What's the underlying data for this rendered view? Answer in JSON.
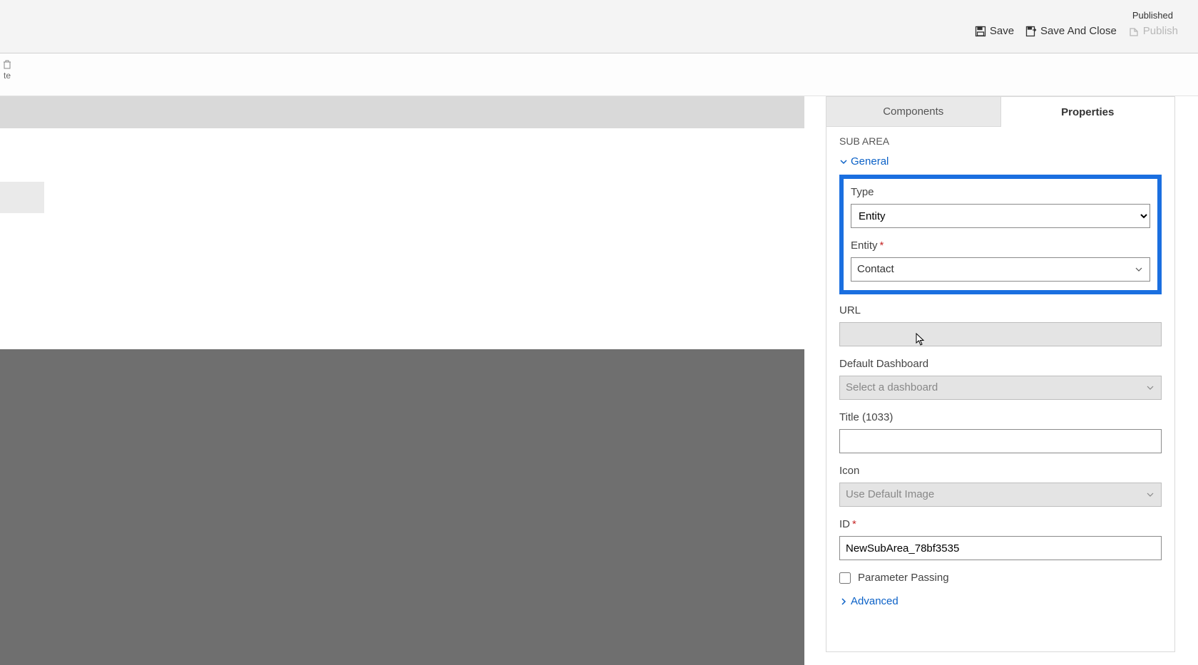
{
  "header": {
    "status_label": "Published",
    "buttons": {
      "save": "Save",
      "save_and_close": "Save And Close",
      "publish": "Publish"
    },
    "delete_label": "te"
  },
  "panel": {
    "tabs": {
      "components": "Components",
      "properties": "Properties"
    },
    "section_title": "SUB AREA",
    "sections": {
      "general": "General",
      "advanced": "Advanced"
    },
    "fields": {
      "type": {
        "label": "Type",
        "value": "Entity"
      },
      "entity": {
        "label": "Entity",
        "value": "Contact"
      },
      "url": {
        "label": "URL",
        "value": ""
      },
      "default_dashboard": {
        "label": "Default Dashboard",
        "placeholder": "Select a dashboard"
      },
      "title": {
        "label": "Title (1033)",
        "value": ""
      },
      "icon": {
        "label": "Icon",
        "value": "Use Default Image"
      },
      "id": {
        "label": "ID",
        "value": "NewSubArea_78bf3535"
      },
      "parameter_passing": {
        "label": "Parameter Passing",
        "checked": false
      }
    }
  }
}
